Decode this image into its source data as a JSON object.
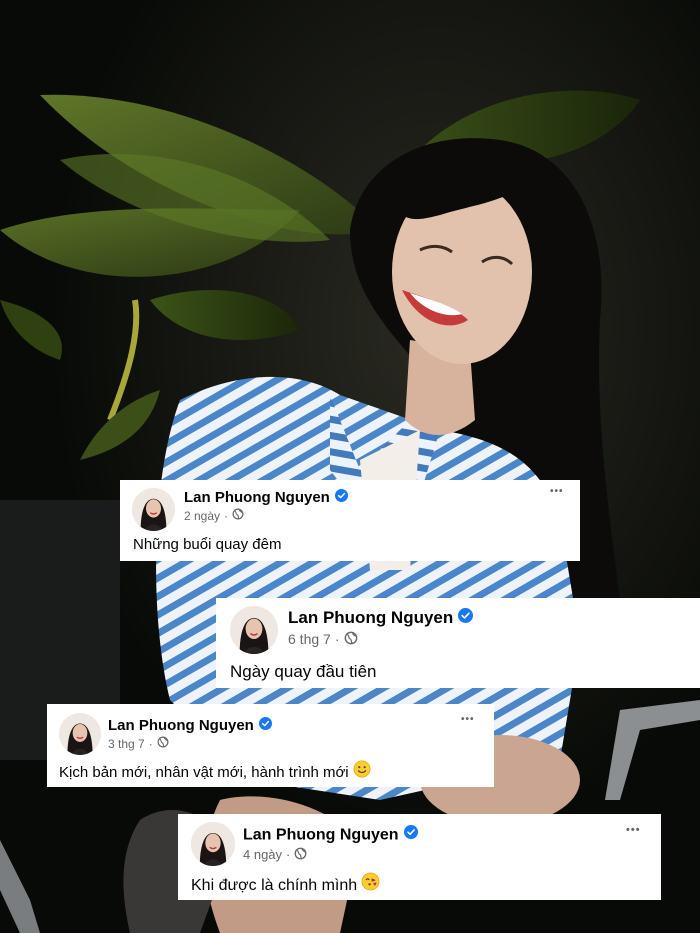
{
  "posts": [
    {
      "author": "Lan Phuong Nguyen",
      "time": "2 ngày",
      "privacy_icon": "globe-icon",
      "text": "Những buổi quay đêm",
      "emoji": "",
      "has_more_menu": true
    },
    {
      "author": "Lan Phuong Nguyen",
      "time": "6 thg 7",
      "privacy_icon": "globe-icon",
      "text": "Ngày quay đầu tiên",
      "emoji": "",
      "has_more_menu": false
    },
    {
      "author": "Lan Phuong Nguyen",
      "time": "3 thg 7",
      "privacy_icon": "globe-icon",
      "text": "Kịch bản mới, nhân vật mới, hành trình mới",
      "emoji": "slightly-smiling-face",
      "has_more_menu": true
    },
    {
      "author": "Lan Phuong Nguyen",
      "time": "4 ngày",
      "privacy_icon": "globe-icon",
      "text": "Khi được là chính mình",
      "emoji": "face-blowing-kiss",
      "has_more_menu": true
    }
  ],
  "more_glyph": "•••",
  "colors": {
    "verified_badge": "#1877f2",
    "meta_text": "#65676b",
    "card_bg": "#ffffff",
    "shirt_stripe": "#4a86c8"
  }
}
